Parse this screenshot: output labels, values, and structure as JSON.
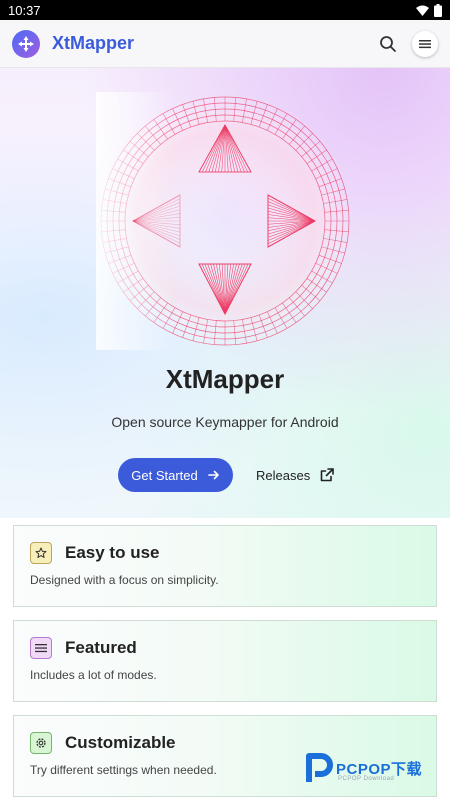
{
  "status_bar": {
    "time": "10:37"
  },
  "navbar": {
    "title": "XtMapper"
  },
  "hero": {
    "title": "XtMapper",
    "subtitle": "Open source Keymapper for Android",
    "primary_button": "Get Started",
    "secondary_link": "Releases"
  },
  "features": [
    {
      "title": "Easy to use",
      "description": "Designed with a focus on simplicity.",
      "icon": "star-icon",
      "icon_bg": "#f7eeb9",
      "icon_border": "#b9a55b"
    },
    {
      "title": "Featured",
      "description": "Includes a lot of modes.",
      "icon": "list-icon",
      "icon_bg": "#f1d9f8",
      "icon_border": "#b67ac9"
    },
    {
      "title": "Customizable",
      "description": "Try different settings when needed.",
      "icon": "settings-icon",
      "icon_bg": "#d8f5d4",
      "icon_border": "#79b46f"
    }
  ],
  "watermark": {
    "brand": "PCPOP下载",
    "sub": "PCPOP Download"
  },
  "colors": {
    "accent": "#3b5bdb",
    "art": "#ec3a63"
  }
}
